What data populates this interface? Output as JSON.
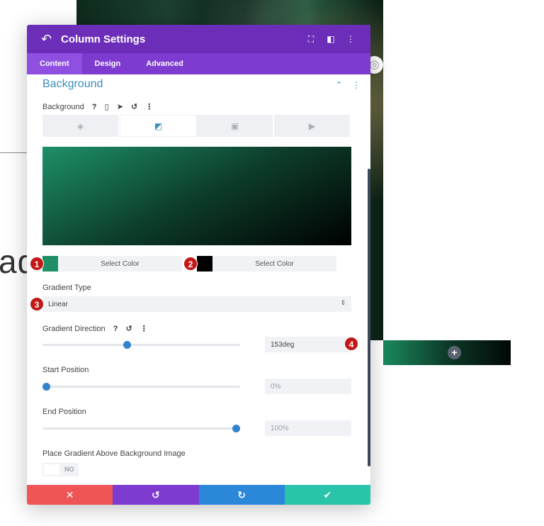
{
  "background_page": {
    "partial_text": "ad",
    "add_section_icon": "plus-icon",
    "globe_icon": "globe-icon"
  },
  "modal": {
    "header": {
      "title": "Column Settings",
      "back_icon": "undo-arrow-icon",
      "icons": [
        "fullscreen-icon",
        "split-view-icon",
        "more-vertical-icon"
      ]
    },
    "tabs": [
      {
        "label": "Content",
        "active": true
      },
      {
        "label": "Design",
        "active": false
      },
      {
        "label": "Advanced",
        "active": false
      }
    ],
    "section": {
      "title": "Background",
      "collapse_icon": "chevron-up-icon",
      "more_icon": "more-vertical-icon"
    },
    "background_field": {
      "label": "Background",
      "icons": [
        "help-icon",
        "mobile-icon",
        "cursor-icon",
        "reset-icon",
        "more-vertical-icon"
      ],
      "type_tabs": [
        {
          "icon": "paint-bucket-icon",
          "active": false
        },
        {
          "icon": "gradient-icon",
          "active": true
        },
        {
          "icon": "image-icon",
          "active": false
        },
        {
          "icon": "video-icon",
          "active": false
        }
      ]
    },
    "gradient": {
      "color1": {
        "swatch": "#1d9068",
        "label": "Select Color",
        "badge": "1"
      },
      "color2": {
        "swatch": "#000000",
        "label": "Select Color",
        "badge": "2"
      },
      "type_label": "Gradient Type",
      "type_value": "Linear",
      "type_badge": "3",
      "direction_label": "Gradient Direction",
      "direction_value": "153deg",
      "direction_badge": "4",
      "direction_fraction": 0.425,
      "start_label": "Start Position",
      "start_value": "0%",
      "start_fraction": 0.0,
      "end_label": "End Position",
      "end_value": "100%",
      "end_fraction": 1.0,
      "place_above_label": "Place Gradient Above Background Image",
      "place_above_value": "NO"
    },
    "footer": [
      {
        "icon": "close-icon",
        "glyph": "✕",
        "color": "#ef5555"
      },
      {
        "icon": "undo-icon",
        "glyph": "↺",
        "color": "#7d3bcf"
      },
      {
        "icon": "redo-icon",
        "glyph": "↻",
        "color": "#2b87da"
      },
      {
        "icon": "check-icon",
        "glyph": "✔",
        "color": "#29c4a9"
      }
    ],
    "colors": {
      "header": "#6c2eb9",
      "tabbar": "#7d3bcf",
      "accent": "#3a8fbf",
      "badge": "#c21818"
    }
  }
}
